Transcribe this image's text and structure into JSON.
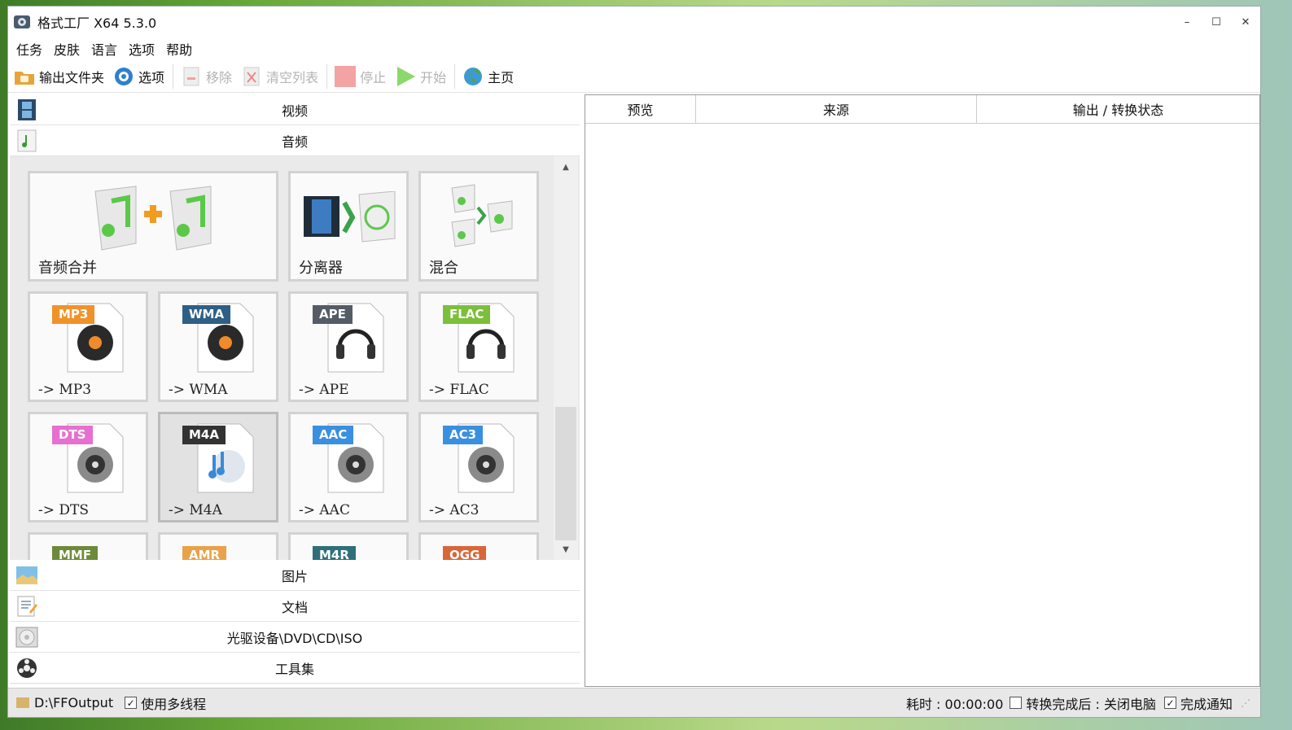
{
  "window": {
    "title": "格式工厂 X64 5.3.0",
    "min": "–",
    "max": "☐",
    "close": "✕"
  },
  "menu": [
    "任务",
    "皮肤",
    "语言",
    "选项",
    "帮助"
  ],
  "toolbar": {
    "output_folder": "输出文件夹",
    "options": "选项",
    "remove": "移除",
    "clear_list": "清空列表",
    "stop": "停止",
    "start": "开始",
    "home": "主页"
  },
  "categories": {
    "video": "视频",
    "audio": "音频",
    "picture": "图片",
    "document": "文档",
    "disc": "光驱设备\\DVD\\CD\\ISO",
    "tools": "工具集"
  },
  "tiles_top": [
    {
      "label": "音频合并"
    },
    {
      "label": "分离器"
    },
    {
      "label": "混合"
    }
  ],
  "formats": [
    {
      "badge": "MP3",
      "label": "-> MP3",
      "color": "#f0922a"
    },
    {
      "badge": "WMA",
      "label": "-> WMA",
      "color": "#2f5f86"
    },
    {
      "badge": "APE",
      "label": "-> APE",
      "color": "#555c66"
    },
    {
      "badge": "FLAC",
      "label": "-> FLAC",
      "color": "#7cbf3a"
    },
    {
      "badge": "DTS",
      "label": "-> DTS",
      "color": "#e66fd0"
    },
    {
      "badge": "M4A",
      "label": "-> M4A",
      "color": "#333333"
    },
    {
      "badge": "AAC",
      "label": "-> AAC",
      "color": "#3b8fe0"
    },
    {
      "badge": "AC3",
      "label": "-> AC3",
      "color": "#3b8fe0"
    }
  ],
  "formats_partial": [
    {
      "badge": "MMF",
      "color": "#6d8a3a"
    },
    {
      "badge": "AMR",
      "color": "#e8a24a"
    },
    {
      "badge": "M4R",
      "color": "#2f6f7a"
    },
    {
      "badge": "OGG",
      "color": "#d8663a"
    }
  ],
  "table_headers": [
    "预览",
    "来源",
    "输出 / 转换状态"
  ],
  "status": {
    "path": "D:\\FFOutput",
    "multithread": "使用多线程",
    "elapsed": "耗时 : 00:00:00",
    "after_done": "转换完成后 : 关闭电脑",
    "notify": "完成通知"
  }
}
